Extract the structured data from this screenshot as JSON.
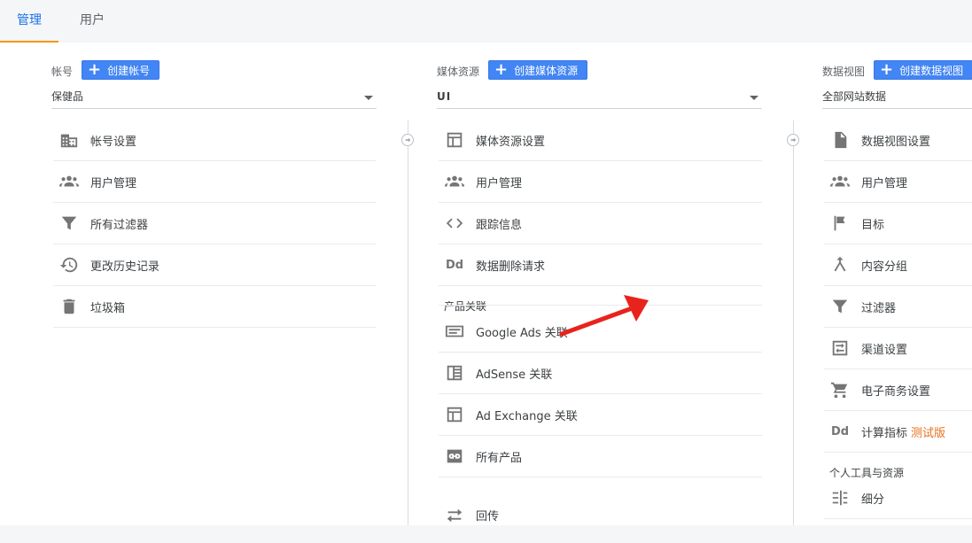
{
  "tabs": [
    {
      "label": "管理",
      "active": true
    },
    {
      "label": "用户",
      "active": false
    }
  ],
  "account": {
    "label": "帐号",
    "create_button": "创建帐号",
    "selected": "保健品",
    "items": [
      {
        "label": "帐号设置",
        "icon": "building-icon"
      },
      {
        "label": "用户管理",
        "icon": "users-icon"
      },
      {
        "label": "所有过滤器",
        "icon": "filter-icon"
      },
      {
        "label": "更改历史记录",
        "icon": "history-icon"
      },
      {
        "label": "垃圾箱",
        "icon": "trash-icon"
      }
    ]
  },
  "property": {
    "label": "媒体资源",
    "create_button": "创建媒体资源",
    "selected": "UI",
    "items": [
      {
        "label": "媒体资源设置",
        "icon": "layout-icon"
      },
      {
        "label": "用户管理",
        "icon": "users-icon"
      },
      {
        "label": "跟踪信息",
        "icon": "code-icon"
      },
      {
        "label": "数据删除请求",
        "icon": "dd-icon"
      }
    ],
    "product_links_title": "产品关联",
    "product_links": [
      {
        "label": "Google Ads 关联",
        "icon": "ads-icon"
      },
      {
        "label": "AdSense 关联",
        "icon": "adsense-icon"
      },
      {
        "label": "Ad Exchange 关联",
        "icon": "adexchange-icon"
      },
      {
        "label": "所有产品",
        "icon": "link-icon"
      }
    ],
    "postback": {
      "label": "回传",
      "icon": "postback-icon"
    }
  },
  "view": {
    "label": "数据视图",
    "create_button": "创建数据视图",
    "selected": "全部网站数据",
    "items": [
      {
        "label": "数据视图设置",
        "icon": "document-icon"
      },
      {
        "label": "用户管理",
        "icon": "users-icon"
      },
      {
        "label": "目标",
        "icon": "flag-icon"
      },
      {
        "label": "内容分组",
        "icon": "grouping-icon"
      },
      {
        "label": "过滤器",
        "icon": "filter-icon"
      },
      {
        "label": "渠道设置",
        "icon": "channel-icon"
      },
      {
        "label": "电子商务设置",
        "icon": "cart-icon"
      },
      {
        "label": "计算指标",
        "icon": "dd-icon",
        "badge": "测试版"
      }
    ],
    "personal_title": "个人工具与资源",
    "personal_items": [
      {
        "label": "细分",
        "icon": "segments-icon"
      }
    ]
  },
  "colors": {
    "accent": "#1a73e8",
    "button": "#4285f4",
    "tab_underline": "#f29900",
    "beta": "#e8711c",
    "annotation_arrow": "#e8231c"
  }
}
